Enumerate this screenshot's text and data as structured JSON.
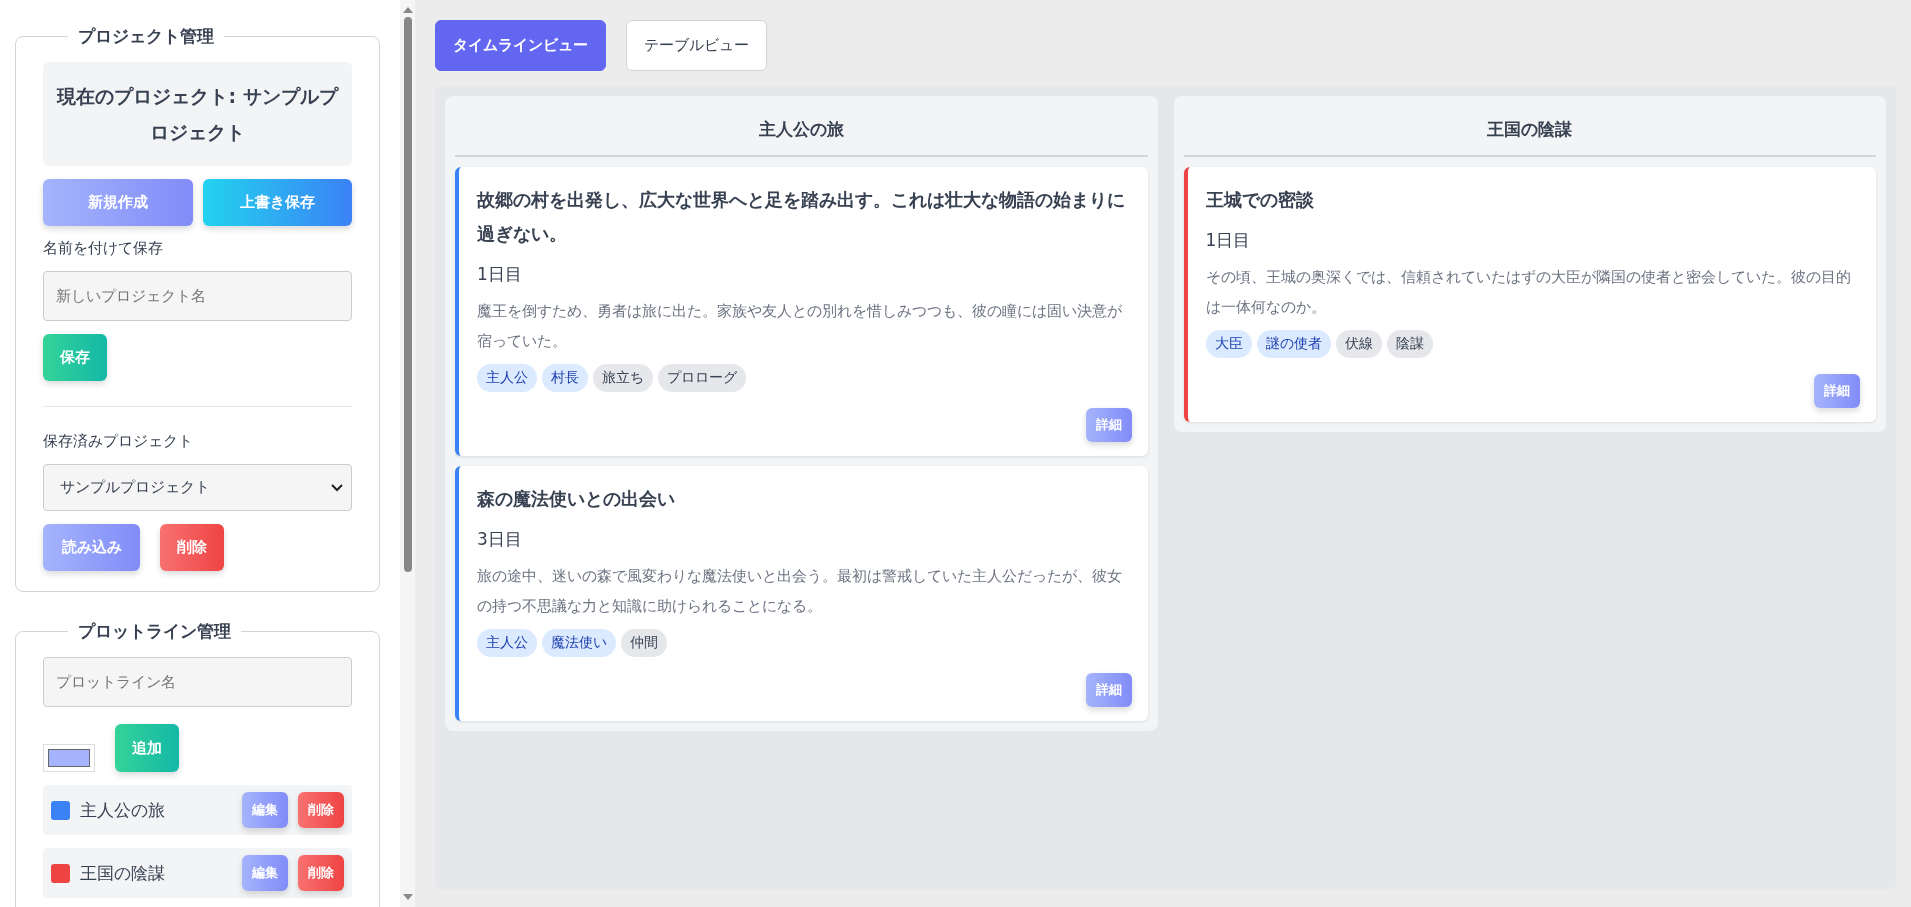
{
  "sidebar": {
    "project": {
      "legend": "プロジェクト管理",
      "current": "現在のプロジェクト: サンプルプロジェクト",
      "new_button": "新規作成",
      "overwrite_button": "上書き保存",
      "save_as_label": "名前を付けて保存",
      "name_placeholder": "新しいプロジェクト名",
      "save_button": "保存",
      "saved_label": "保存済みプロジェクト",
      "saved_select": "サンプルプロジェクト",
      "load_button": "読み込み",
      "delete_button": "削除"
    },
    "plotlines": {
      "legend": "プロットライン管理",
      "name_placeholder": "プロットライン名",
      "add_button": "追加",
      "items": [
        {
          "name": "主人公の旅",
          "color": "#3b82f6",
          "edit": "編集",
          "delete": "削除"
        },
        {
          "name": "王国の陰謀",
          "color": "#ef4444",
          "edit": "編集",
          "delete": "削除"
        }
      ]
    }
  },
  "view_tabs": [
    {
      "label": "タイムラインビュー",
      "selected": true
    },
    {
      "label": "テーブルビュー",
      "selected": false
    }
  ],
  "timeline": [
    {
      "title": "主人公の旅",
      "color": "#3b82f6",
      "events": [
        {
          "title": "故郷の村を出発し、広大な世界へと足を踏み出す。これは壮大な物語の始まりに過ぎない。",
          "day": "1日目",
          "description": "魔王を倒すため、勇者は旅に出た。家族や友人との別れを惜しみつつも、彼の瞳には固い決意が宿っていた。",
          "tags": [
            {
              "label": "主人公",
              "kind": "character"
            },
            {
              "label": "村長",
              "kind": "character"
            },
            {
              "label": "旅立ち",
              "kind": "keyword"
            },
            {
              "label": "プロローグ",
              "kind": "keyword"
            }
          ],
          "detail_button": "詳細"
        },
        {
          "title": "森の魔法使いとの出会い",
          "day": "3日目",
          "description": "旅の途中、迷いの森で風変わりな魔法使いと出会う。最初は警戒していた主人公だったが、彼女の持つ不思議な力と知識に助けられることになる。",
          "tags": [
            {
              "label": "主人公",
              "kind": "character"
            },
            {
              "label": "魔法使い",
              "kind": "character"
            },
            {
              "label": "仲間",
              "kind": "keyword"
            }
          ],
          "detail_button": "詳細"
        }
      ]
    },
    {
      "title": "王国の陰謀",
      "color": "#ef4444",
      "events": [
        {
          "title": "王城での密談",
          "day": "1日目",
          "description": "その頃、王城の奥深くでは、信頼されていたはずの大臣が隣国の使者と密会していた。彼の目的は一体何なのか。",
          "tags": [
            {
              "label": "大臣",
              "kind": "character"
            },
            {
              "label": "謎の使者",
              "kind": "character"
            },
            {
              "label": "伏線",
              "kind": "keyword"
            },
            {
              "label": "陰謀",
              "kind": "keyword"
            }
          ],
          "detail_button": "詳細"
        }
      ]
    }
  ]
}
